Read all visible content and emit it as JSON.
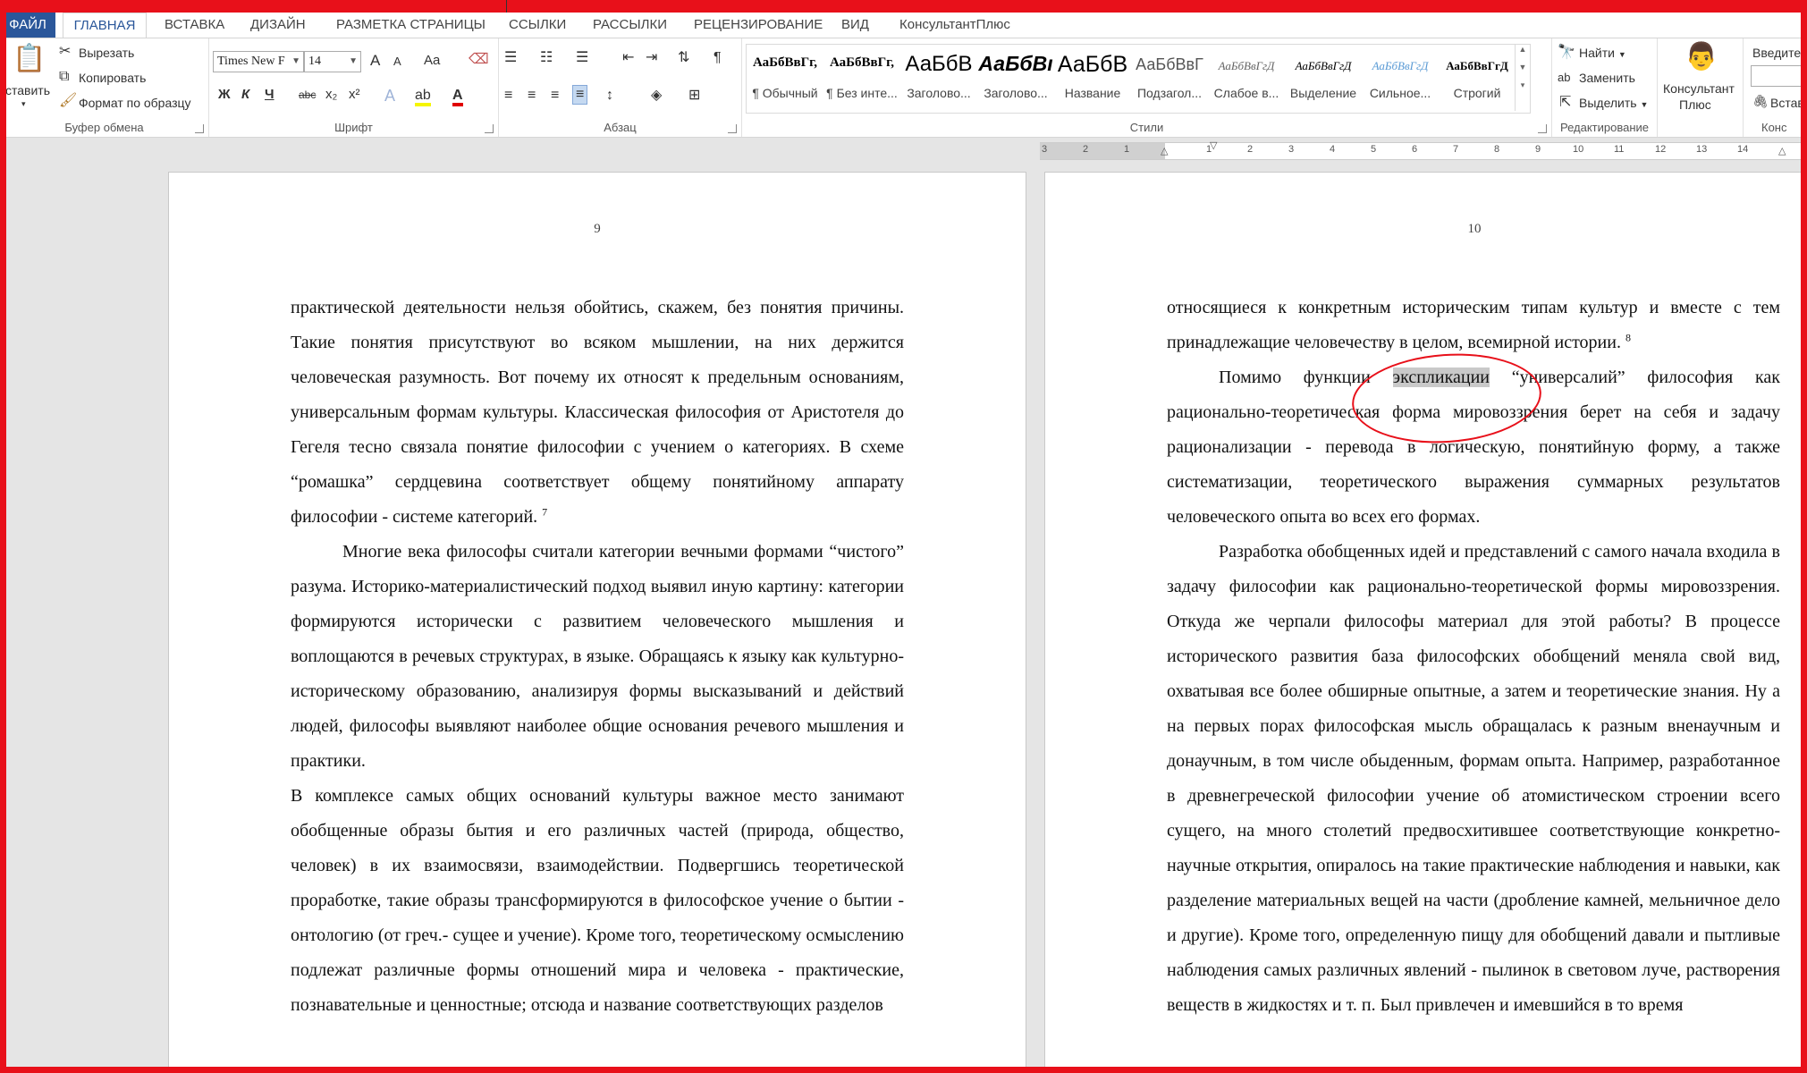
{
  "tabs": {
    "file": "ФАЙЛ",
    "home": "ГЛАВНАЯ",
    "insert": "ВСТАВКА",
    "design": "ДИЗАЙН",
    "layout": "РАЗМЕТКА СТРАНИЦЫ",
    "references": "ССЫЛКИ",
    "mailings": "РАССЫЛКИ",
    "review": "РЕЦЕНЗИРОВАНИЕ",
    "view": "ВИД",
    "consultant": "КонсультантПлюс"
  },
  "clipboard": {
    "paste": "ставить",
    "cut": "Вырезать",
    "copy": "Копировать",
    "format_painter": "Формат по образцу",
    "label": "Буфер обмена"
  },
  "font": {
    "name": "Times New F",
    "size": "14",
    "grow": "A",
    "shrink": "A",
    "case": "Aa",
    "bold": "Ж",
    "italic": "К",
    "underline": "Ч",
    "strike": "abc",
    "subscript": "x₂",
    "superscript": "x²",
    "label": "Шрифт"
  },
  "paragraph": {
    "label": "Абзац"
  },
  "styles": {
    "label": "Стили",
    "items": [
      {
        "sample": "АаБбВвГг,",
        "name": "¶ Обычный"
      },
      {
        "sample": "АаБбВвГг,",
        "name": "¶ Без инте..."
      },
      {
        "sample": "АаБбВ",
        "name": "Заголово..."
      },
      {
        "sample": "АаБбВı",
        "name": "Заголово..."
      },
      {
        "sample": "АаБбВ",
        "name": "Название"
      },
      {
        "sample": "АаБбВвГ",
        "name": "Подзагол..."
      },
      {
        "sample": "АаБбВвГгД",
        "name": "Слабое в..."
      },
      {
        "sample": "АаБбВвГгД",
        "name": "Выделение"
      },
      {
        "sample": "АаБбВвГгД",
        "name": "Сильное..."
      },
      {
        "sample": "АаБбВвГгД",
        "name": "Строгий"
      }
    ]
  },
  "editing": {
    "find": "Найти",
    "replace": "Заменить",
    "select": "Выделить",
    "label": "Редактирование"
  },
  "consultant_group": {
    "button_line1": "Консультант",
    "button_line2": "Плюс",
    "input_hint": "Введите т",
    "insert": "Встав",
    "label": "Конс"
  },
  "ruler": {
    "numbers": [
      "3",
      "2",
      "1",
      "1",
      "2",
      "3",
      "4",
      "5",
      "6",
      "7",
      "8",
      "9",
      "10",
      "11",
      "12",
      "13",
      "14"
    ]
  },
  "page_left": {
    "number": "9",
    "p1": "практической деятельности нельзя обойтись, скажем, без понятия причины. Такие понятия присутствуют во всяком мышлении, на них держится человеческая разумность. Вот почему их относят к предельным основаниям, универсальным формам культуры. Классическая философия от Аристотеля до Гегеля тесно связала понятие философии с учением о категориях. В схеме “ромашка” сердцевина соответствует общему понятийному аппарату философии - системе категорий.",
    "p1_ref": "7",
    "p2": "Многие века философы считали категории вечными формами “чистого” разума. Историко-материалистический подход выявил иную картину: категории формируются исторически с развитием человеческого мышления и воплощаются в речевых структурах, в языке. Обращаясь к языку как культурно-историческому образованию, анализируя формы высказываний и действий людей, философы выявляют наиболее общие основания речевого мышления и практики.",
    "p3": "В комплексе самых общих оснований культуры важное место занимают обобщенные образы бытия и его различных частей (природа, общество, человек) в их взаимосвязи, взаимодействии. Подвергшись теоретической проработке, такие образы трансформируются в философское учение о бытии - онтологию (от греч.- сущее и учение). Кроме того, теоретическому осмыслению подлежат различные формы отношений мира и человека - практические, познавательные и ценностные; отсюда и название соответствующих разделов"
  },
  "page_right": {
    "number": "10",
    "p1": "относящиеся к конкретным историческим типам культур и вместе с тем принадлежащие человечеству в целом, всемирной истории.",
    "p1_ref": "8",
    "p2_a": "Помимо функции ",
    "p2_hl": "экспликации",
    "p2_b": " “универсалий” философия как рационально-теоретическая форма мировоззрения берет на себя и задачу рационализации - перевода в логическую, понятийную форму, а также систематизации, теоретического выражения суммарных результатов человеческого опыта во всех его формах.",
    "p3": "Разработка обобщенных идей и представлений с самого начала входила в задачу философии как рационально-теоретической формы мировоззрения. Откуда же черпали философы материал для этой работы? В процессе исторического развития база философских обобщений меняла свой вид, охватывая все более обширные опытные, а затем и теоретические знания. Ну а на первых порах философская мысль обращалась к разным вненаучным и донаучным, в том числе обыденным, формам опыта. Например, разработанное в древнегреческой философии учение об атомистическом строении всего сущего, на много столетий предвосхитившее соответствующие конкретно-научные открытия, опиралось на такие практические наблюдения и навыки, как разделение материальных вещей на части (дробление камней, мельничное дело и другие). Кроме того, определенную пищу для обобщений давали и пытливые наблюдения самых различных явлений - пылинок в световом луче, растворения веществ в жидкостях и т. п. Был привлечен и имевшийся в то время"
  }
}
